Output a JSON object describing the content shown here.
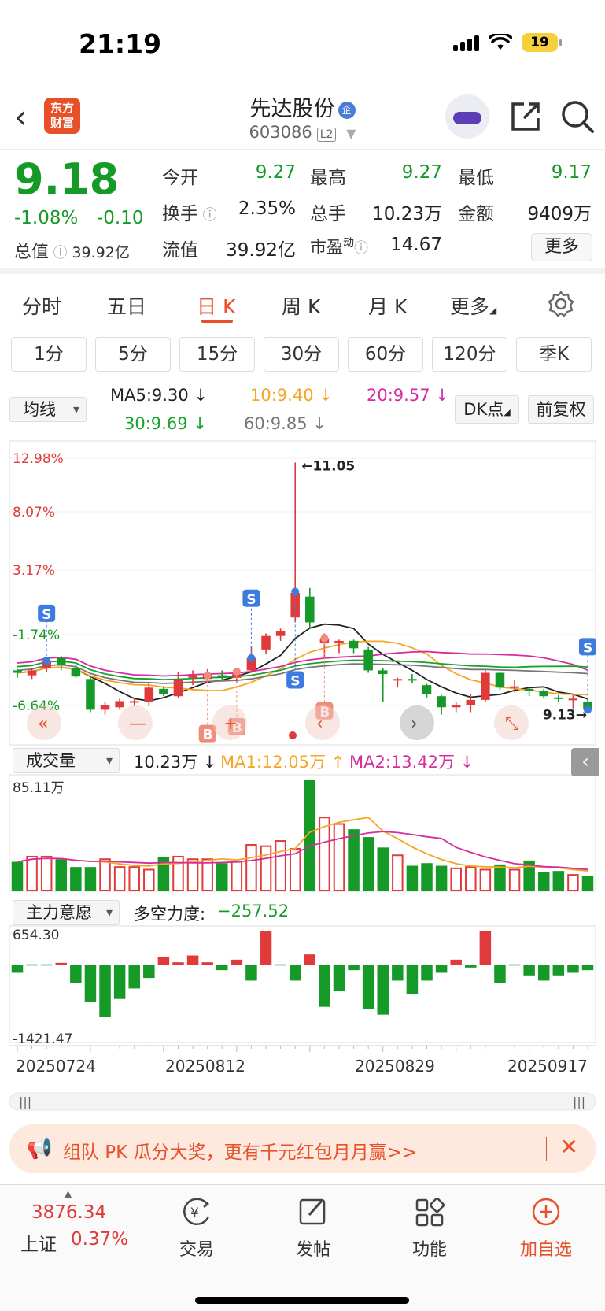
{
  "status": {
    "time": "21:19",
    "battery": "19"
  },
  "header": {
    "logo": [
      "东方",
      "财富"
    ],
    "name": "先达股份",
    "corp_badge": "企",
    "code": "603086",
    "level": "L2"
  },
  "quote": {
    "price": "9.18",
    "change_pct": "-1.08%",
    "change": "-0.10",
    "total_mv_label": "总值",
    "total_mv": "39.92亿",
    "open_label": "今开",
    "open": "9.27",
    "high_label": "最高",
    "high": "9.27",
    "low_label": "最低",
    "low": "9.17",
    "turnover_label": "换手",
    "turnover": "2.35%",
    "vol_label": "总手",
    "vol": "10.23万",
    "amount_label": "金额",
    "amount": "9409万",
    "float_label": "流值",
    "float_mv": "39.92亿",
    "pe_label": "市盈",
    "pe_sup": "动",
    "pe": "14.67",
    "more": "更多"
  },
  "tabs": [
    "分时",
    "五日",
    "日 K",
    "周 K",
    "月 K",
    "更多"
  ],
  "active_tab": 2,
  "subtabs": [
    "1分",
    "5分",
    "15分",
    "30分",
    "60分",
    "120分",
    "季K"
  ],
  "ma": {
    "selector": "均线",
    "ma5": "MA5:9.30",
    "ma10": "10:9.40",
    "ma20": "20:9.57",
    "ma30": "30:9.69",
    "ma60": "60:9.85",
    "dk": "DK点",
    "fuquan": "前复权",
    "colors": {
      "ma5": "#222222",
      "ma10": "#f5a623",
      "ma20": "#d62ca0",
      "ma30": "#13a32a",
      "ma60": "#777777"
    }
  },
  "kline": {
    "pct_labels": [
      "12.98%",
      "8.07%",
      "3.17%",
      "-1.74%",
      "-6.64%"
    ],
    "high_mark": "11.05",
    "low_mark": "9.13",
    "signals": [
      "S",
      "B"
    ]
  },
  "volume": {
    "selector": "成交量",
    "value": "10.23万",
    "ma1": "MA1:12.05万",
    "ma2": "MA2:13.42万",
    "max_label": "85.11万"
  },
  "zhuli": {
    "selector": "主力意愿",
    "label": "多空力度:",
    "value": "−257.52",
    "max_label": "654.30",
    "min_label": "-1421.47"
  },
  "dates": [
    "20250724",
    "20250812",
    "20250829",
    "20250917"
  ],
  "promo": {
    "text": "组队 PK 瓜分大奖，更有千元红包月月赢>>"
  },
  "bottom": {
    "index_value": "3876.34",
    "index_name": "上证",
    "index_pct": "0.37%",
    "items": [
      "交易",
      "发帖",
      "功能",
      "加自选"
    ]
  },
  "colors": {
    "up": "#e03a3a",
    "down": "#159a28",
    "accent": "#e8502a"
  },
  "chart_data": {
    "type": "candlestick",
    "candles": [
      {
        "o": 9.36,
        "c": 9.34,
        "h": 9.37,
        "l": 9.3
      },
      {
        "o": 9.32,
        "c": 9.36,
        "h": 9.38,
        "l": 9.29
      },
      {
        "o": 9.38,
        "c": 9.44,
        "h": 9.47,
        "l": 9.35
      },
      {
        "o": 9.46,
        "c": 9.4,
        "h": 9.48,
        "l": 9.36
      },
      {
        "o": 9.38,
        "c": 9.31,
        "h": 9.4,
        "l": 9.3
      },
      {
        "o": 9.29,
        "c": 9.04,
        "h": 9.3,
        "l": 9.02
      },
      {
        "o": 9.04,
        "c": 9.08,
        "h": 9.1,
        "l": 9.0
      },
      {
        "o": 9.06,
        "c": 9.11,
        "h": 9.13,
        "l": 9.04
      },
      {
        "o": 9.1,
        "c": 9.11,
        "h": 9.14,
        "l": 9.07
      },
      {
        "o": 9.1,
        "c": 9.22,
        "h": 9.26,
        "l": 9.07
      },
      {
        "o": 9.21,
        "c": 9.17,
        "h": 9.23,
        "l": 9.15
      },
      {
        "o": 9.15,
        "c": 9.28,
        "h": 9.35,
        "l": 9.14
      },
      {
        "o": 9.3,
        "c": 9.32,
        "h": 9.36,
        "l": 9.24
      },
      {
        "o": 9.29,
        "c": 9.33,
        "h": 9.37,
        "l": 9.26
      },
      {
        "o": 9.32,
        "c": 9.3,
        "h": 9.36,
        "l": 9.28
      },
      {
        "o": 9.3,
        "c": 9.33,
        "h": 9.36,
        "l": 9.26
      },
      {
        "o": 9.36,
        "c": 9.46,
        "h": 9.56,
        "l": 9.34
      },
      {
        "o": 9.53,
        "c": 9.64,
        "h": 9.66,
        "l": 9.49
      },
      {
        "o": 9.64,
        "c": 9.68,
        "h": 9.7,
        "l": 9.6
      },
      {
        "o": 9.79,
        "c": 9.99,
        "h": 11.05,
        "l": 9.75
      },
      {
        "o": 9.96,
        "c": 9.75,
        "h": 10.03,
        "l": 9.7
      },
      {
        "o": 9.58,
        "c": 9.62,
        "h": 9.66,
        "l": 9.47
      },
      {
        "o": 9.58,
        "c": 9.6,
        "h": 9.61,
        "l": 9.5
      },
      {
        "o": 9.6,
        "c": 9.54,
        "h": 9.61,
        "l": 9.5
      },
      {
        "o": 9.53,
        "c": 9.36,
        "h": 9.55,
        "l": 9.34
      },
      {
        "o": 9.36,
        "c": 9.33,
        "h": 9.38,
        "l": 9.1
      },
      {
        "o": 9.29,
        "c": 9.29,
        "h": 9.3,
        "l": 9.22
      },
      {
        "o": 9.29,
        "c": 9.28,
        "h": 9.33,
        "l": 9.26
      },
      {
        "o": 9.24,
        "c": 9.17,
        "h": 9.25,
        "l": 9.14
      },
      {
        "o": 9.15,
        "c": 9.06,
        "h": 9.16,
        "l": 9.0
      },
      {
        "o": 9.06,
        "c": 9.08,
        "h": 9.1,
        "l": 9.02
      },
      {
        "o": 9.08,
        "c": 9.12,
        "h": 9.17,
        "l": 9.02
      },
      {
        "o": 9.12,
        "c": 9.34,
        "h": 9.36,
        "l": 9.1
      },
      {
        "o": 9.34,
        "c": 9.22,
        "h": 9.35,
        "l": 9.2
      },
      {
        "o": 9.23,
        "c": 9.23,
        "h": 9.28,
        "l": 9.18
      },
      {
        "o": 9.21,
        "c": 9.19,
        "h": 9.22,
        "l": 9.15
      },
      {
        "o": 9.19,
        "c": 9.15,
        "h": 9.21,
        "l": 9.13
      },
      {
        "o": 9.14,
        "c": 9.13,
        "h": 9.16,
        "l": 9.1
      },
      {
        "o": 9.13,
        "c": 9.13,
        "h": 9.16,
        "l": 9.05
      },
      {
        "o": 9.1,
        "c": 9.04,
        "h": 9.13,
        "l": 9.03
      }
    ],
    "volume": [
      22,
      26,
      26,
      24,
      18,
      18,
      24,
      18,
      18,
      16,
      26,
      26,
      24,
      24,
      21,
      22,
      35,
      34,
      38,
      32,
      85,
      56,
      51,
      47,
      41,
      33,
      27,
      19,
      21,
      19,
      17,
      18,
      16,
      20,
      16,
      23,
      14,
      15,
      12,
      11
    ],
    "zhuli": [
      -150,
      0,
      0,
      40,
      -350,
      -700,
      -1000,
      -650,
      -450,
      -250,
      150,
      50,
      180,
      50,
      -100,
      100,
      -300,
      650,
      0,
      -300,
      200,
      -800,
      -500,
      -100,
      -850,
      -950,
      -300,
      -550,
      -300,
      -150,
      100,
      -50,
      650,
      -350,
      0,
      -200,
      -300,
      -200,
      -150,
      -100
    ],
    "ma_lines": [
      "MA5",
      "MA10",
      "MA20",
      "MA30",
      "MA60"
    ]
  }
}
